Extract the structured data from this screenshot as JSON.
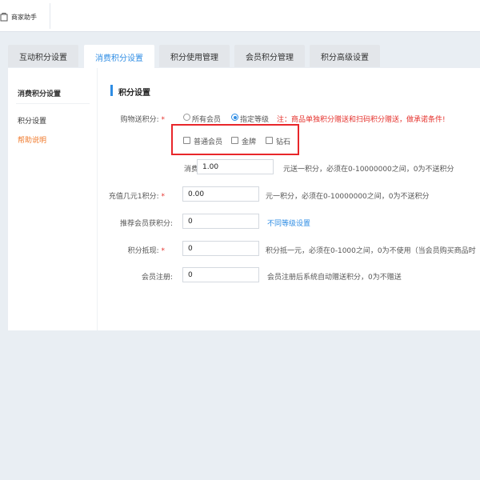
{
  "header": {
    "brand_label": "商家助手"
  },
  "tabs": [
    {
      "label": "互动积分设置",
      "active": false
    },
    {
      "label": "消费积分设置",
      "active": true
    },
    {
      "label": "积分使用管理",
      "active": false
    },
    {
      "label": "会员积分管理",
      "active": false
    },
    {
      "label": "积分高级设置",
      "active": false
    }
  ],
  "sidebar": {
    "title": "消费积分设置",
    "items": [
      {
        "label": "积分设置",
        "current": true
      },
      {
        "label": "帮助说明",
        "current": false
      }
    ]
  },
  "section": {
    "title": "积分设置"
  },
  "form": {
    "purchase": {
      "label": "购物送积分:",
      "required_mark": "*",
      "options": [
        {
          "label": "所有会员",
          "selected": false
        },
        {
          "label": "指定等级",
          "selected": true
        }
      ],
      "note": "注：商品单独积分赠送和扫码积分赠送，做承诺条件!",
      "levels": [
        {
          "label": "普通会员",
          "checked": false
        },
        {
          "label": "金牌",
          "checked": false
        },
        {
          "label": "钻石",
          "checked": false
        }
      ],
      "spend_prefix": "消费",
      "spend_value": "1.00",
      "spend_hint": "元送一积分，必须在0-10000000之间，0为不送积分"
    },
    "recharge": {
      "label": "充值几元1积分:",
      "required_mark": "*",
      "value": "0.00",
      "hint": "元一积分，必须在0-10000000之间，0为不送积分"
    },
    "referral": {
      "label": "推荐会员获积分:",
      "value": "0",
      "link": "不同等级设置"
    },
    "deduction": {
      "label": "积分抵现:",
      "required_mark": "*",
      "value": "0",
      "hint": "积分抵一元，必须在0-1000之间，0为不使用（当会员购买商品时"
    },
    "registration": {
      "label": "会员注册:",
      "value": "0",
      "hint": "会员注册后系统自动赠送积分，0为不赠送"
    }
  },
  "colors": {
    "accent": "#2f8de4",
    "warning": "#e5322d",
    "help_link": "#f07a2c",
    "highlight_box": "#e8262a"
  }
}
